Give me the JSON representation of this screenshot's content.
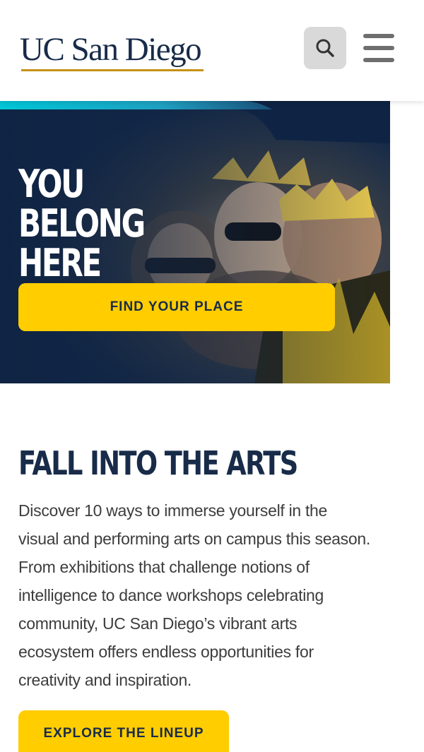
{
  "header": {
    "logo_text": "UC San Diego",
    "search_icon": "search-icon",
    "menu_icon": "hamburger-menu-icon"
  },
  "hero": {
    "title": "YOU BELONG\nHERE",
    "cta_label": "FIND YOUR PLACE"
  },
  "feature": {
    "title": "FALL INTO THE ARTS",
    "body": "Discover 10 ways to immerse yourself in the visual and performing arts on campus this season. From exhibitions that challenge notions of intelligence to dance workshops celebrating community, UC San Diego’s vibrant arts ecosystem offers endless opportunities for creativity and inspiration.",
    "cta_label": "EXPLORE THE LINEUP"
  },
  "colors": {
    "navy": "#182b49",
    "gold": "#ffcd00",
    "logo_underline": "#c69214",
    "accent_cyan": "#00c6d7"
  }
}
